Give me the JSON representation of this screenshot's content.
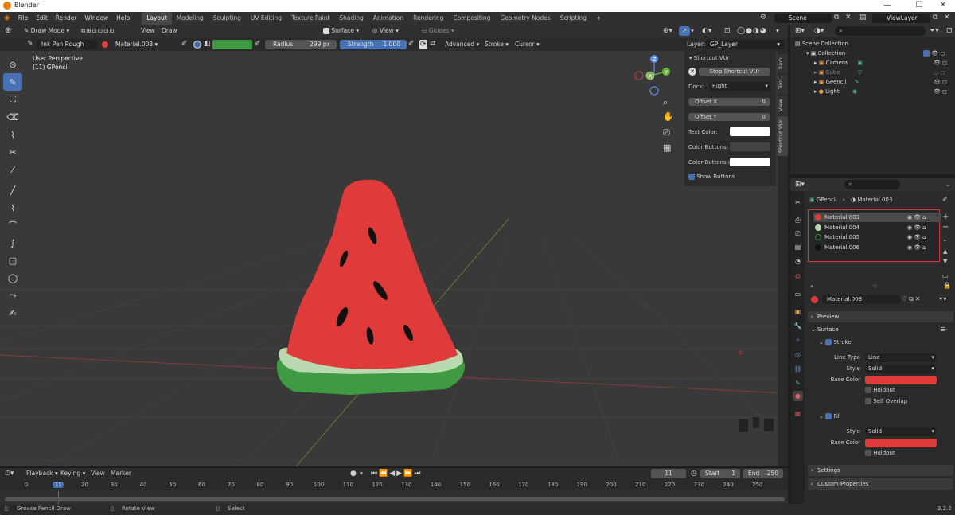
{
  "window": {
    "title": "Blender",
    "controls": [
      "—",
      "☐",
      "✕"
    ]
  },
  "menus": [
    "File",
    "Edit",
    "Render",
    "Window",
    "Help"
  ],
  "workspaces": [
    "Layout",
    "Modeling",
    "Sculpting",
    "UV Editing",
    "Texture Paint",
    "Shading",
    "Animation",
    "Rendering",
    "Compositing",
    "Geometry Nodes",
    "Scripting"
  ],
  "scene": "Scene",
  "view_layer": "ViewLayer",
  "header": {
    "mode": "Draw Mode",
    "view": "View",
    "draw": "Draw",
    "surface": "Surface",
    "view2": "View",
    "guides": "Guides",
    "layer_label": "Layer:",
    "layer_value": "GP_Layer"
  },
  "tool_settings": {
    "brush": "Ink Pen Rough",
    "material": "Material.003",
    "radius_label": "Radius",
    "radius_value": "299 px",
    "strength_label": "Strength",
    "strength_value": "1.000",
    "advanced": "Advanced",
    "stroke": "Stroke",
    "cursor": "Cursor"
  },
  "viewport": {
    "perspective": "User Perspective",
    "object": "(11) GPencil",
    "gizmo_z": "Z",
    "gizmo_y": "Y",
    "gizmo_x": "X"
  },
  "npanel": {
    "title": "Shortcut VUr",
    "stop_button": "Stop Shortcut VUr",
    "dock_label": "Dock:",
    "dock_value": "Right",
    "offset_x_label": "Offset X",
    "offset_x_value": "0",
    "offset_y_label": "Offset Y",
    "offset_y_value": "0",
    "text_color_label": "Text Color:",
    "color_buttons_label": "Color Buttons:",
    "color_buttons_a_label": "Color Buttons a..",
    "show_buttons_label": "Show Buttons",
    "tabs": [
      "Item",
      "Tool",
      "View",
      "Shortcut VUr"
    ]
  },
  "timeline": {
    "menus": [
      "Playback",
      "Keying",
      "View",
      "Marker"
    ],
    "current_frame": "11",
    "start_label": "Start",
    "start_value": "1",
    "end_label": "End",
    "end_value": "250",
    "ticks": [
      "0",
      "11",
      "20",
      "30",
      "40",
      "50",
      "60",
      "70",
      "80",
      "90",
      "100",
      "110",
      "120",
      "130",
      "140",
      "150",
      "160",
      "170",
      "180",
      "190",
      "200",
      "210",
      "220",
      "230",
      "240",
      "250"
    ]
  },
  "statusbar": {
    "left": "Grease Pencil Draw",
    "middle": "Rotate View",
    "right": "Select",
    "version": "3.2.2"
  },
  "outliner": {
    "scene_collection": "Scene Collection",
    "collection": "Collection",
    "items": [
      "Camera",
      "Cube",
      "GPencil",
      "Light"
    ]
  },
  "properties": {
    "breadcrumb_object": "GPencil",
    "breadcrumb_material": "Material.003",
    "materials": [
      "Material.003",
      "Material.004",
      "Material.005",
      "Material.006"
    ],
    "material_colors": [
      "#e03b3b",
      "#b9d9b0",
      "#2f8a35",
      "#111111"
    ],
    "active_material": "Material.003",
    "preview": "Preview",
    "surface": "Surface",
    "stroke": "Stroke",
    "line_type_label": "Line Type",
    "line_type_value": "Line",
    "style_label": "Style",
    "style_value": "Solid",
    "base_color_label": "Base Color",
    "holdout": "Holdout",
    "self_overlap": "Self Overlap",
    "fill": "Fill",
    "fill_style_label": "Style",
    "fill_style_value": "Solid",
    "fill_base_color_label": "Base Color",
    "fill_holdout": "Holdout",
    "settings": "Settings",
    "custom_properties": "Custom Properties"
  },
  "colors": {
    "accent": "#4772b3",
    "stroke_color": "#e03b3b",
    "fill_color": "#e03b3b",
    "watermelon_red": "#e03b3b",
    "rind_light": "#b9d9b0",
    "rind_dark": "#2f8a35"
  }
}
